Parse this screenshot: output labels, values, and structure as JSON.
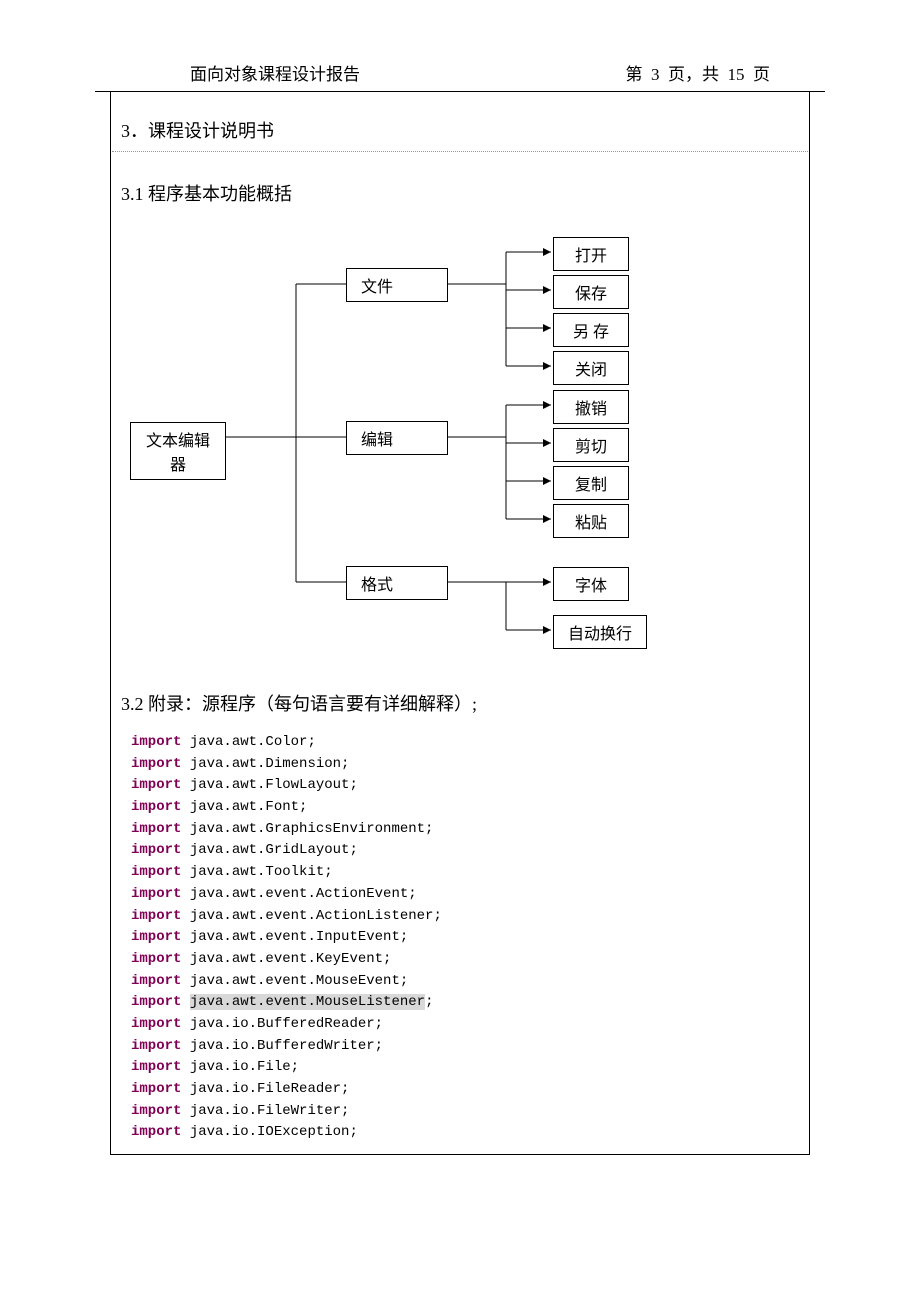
{
  "header": {
    "title": "面向对象课程设计报告",
    "pager_prefix": "第",
    "current_page": "3",
    "pager_mid": "页，共",
    "total_pages": "15",
    "pager_suffix": "页"
  },
  "section3": {
    "title": "3．课程设计说明书",
    "sub1": "3.1 程序基本功能概括",
    "sub2": "3.2 附录：源程序（每句语言要有详细解释）;"
  },
  "diagram": {
    "root": "文本编辑器",
    "file": "文件",
    "edit": "编辑",
    "format": "格式",
    "open": "打开",
    "save": "保存",
    "saveas": "另   存",
    "close": "关闭",
    "undo": "撤销",
    "cut": "剪切",
    "copy": "复制",
    "paste": "粘贴",
    "font": "字体",
    "wrap": "自动换行"
  },
  "code": {
    "kw": "import",
    "lines": [
      " java.awt.Color;",
      " java.awt.Dimension;",
      " java.awt.FlowLayout;",
      " java.awt.Font;",
      " java.awt.GraphicsEnvironment;",
      " java.awt.GridLayout;",
      " java.awt.Toolkit;",
      " java.awt.event.ActionEvent;",
      " java.awt.event.ActionListener;",
      " java.awt.event.InputEvent;",
      " java.awt.event.KeyEvent;",
      " java.awt.event.MouseEvent;",
      "java.awt.event.MouseListener",
      " java.io.BufferedReader;",
      " java.io.BufferedWriter;",
      " java.io.File;",
      " java.io.FileReader;",
      " java.io.FileWriter;",
      " java.io.IOException;"
    ]
  }
}
